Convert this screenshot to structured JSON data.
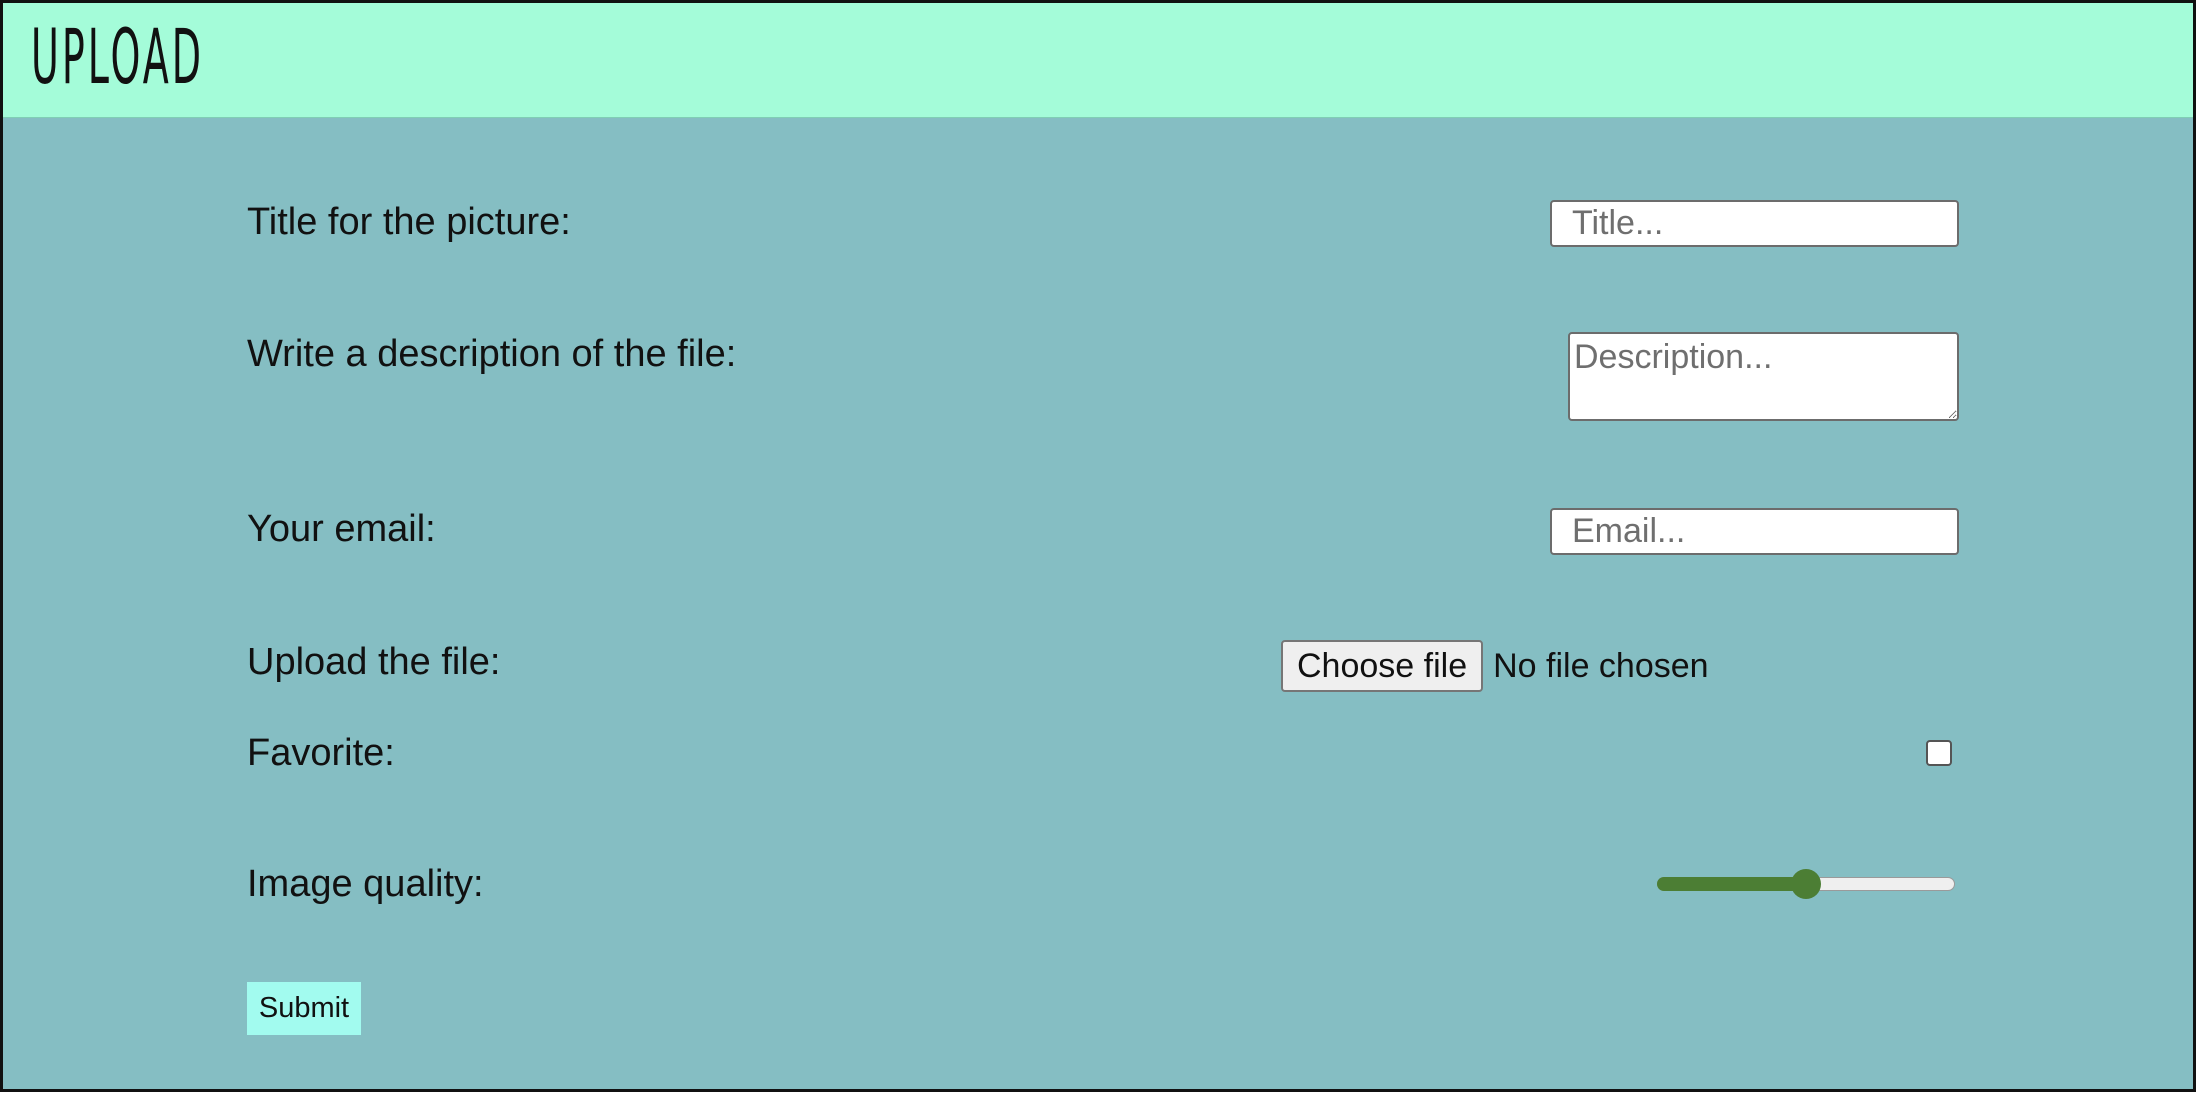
{
  "header": {
    "title": "UPLOAD"
  },
  "form": {
    "title_label": "Title for the picture:",
    "title_placeholder": "Title...",
    "description_label": "Write a description of the file:",
    "description_placeholder": "Description...",
    "email_label": "Your email:",
    "email_placeholder": "Email...",
    "file_label": "Upload the file:",
    "file_button": "Choose file",
    "file_status": "No file chosen",
    "favorite_label": "Favorite:",
    "favorite_checked": false,
    "quality_label": "Image quality:",
    "quality_fraction": 0.5,
    "submit_label": "Submit"
  },
  "colors": {
    "header_background": "#a4fcd9",
    "page_background": "#85bec3",
    "slider_accent": "#4c7e34",
    "submit_background": "#a2fbef"
  }
}
